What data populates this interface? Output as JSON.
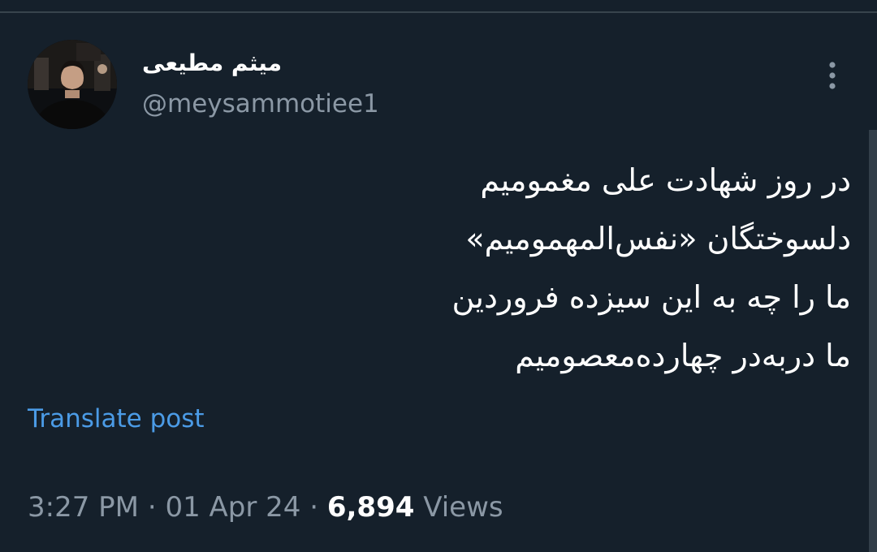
{
  "post": {
    "author": {
      "display_name": "میثم مطیعی",
      "handle": "@meysammotiee1",
      "avatar_icon": "profile-photo"
    },
    "more_icon": "three-dots-vertical-icon",
    "text_lines": [
      "در روز شهادت علی مغمومیم",
      "دلسوختگان «نفس‌المهمومیم»",
      "ما را چه به این سیزده فروردین",
      "ما دربه‌در چهارده‌معصومیم"
    ],
    "translate_label": "Translate post",
    "time": "3:27 PM",
    "separator": "·",
    "date": "01 Apr 24",
    "views_count": "6,894",
    "views_label": "Views"
  },
  "colors": {
    "background": "#15202b",
    "text": "#ffffff",
    "secondary_text": "#8b98a5",
    "link": "#4b9be6",
    "divider": "#38444d"
  }
}
